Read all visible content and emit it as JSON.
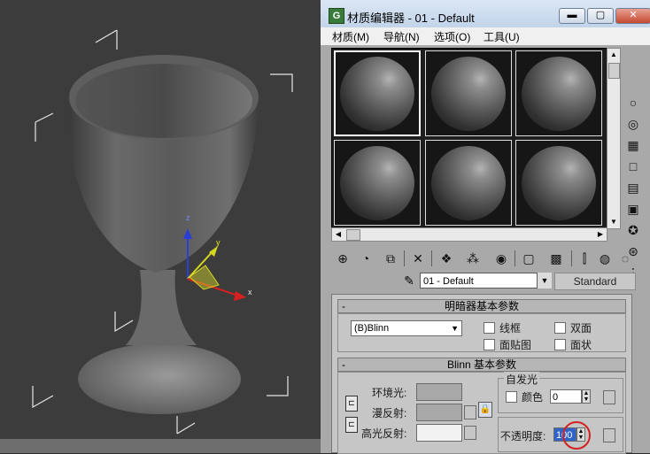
{
  "viewport": {
    "axes": {
      "z": "z",
      "y": "y",
      "x": "x"
    }
  },
  "window": {
    "title": "材质编辑器 - 01 - Default",
    "app_icon": "G",
    "buttons": {
      "minimize": "▬",
      "maximize": "▢",
      "close": "✕"
    }
  },
  "menu": {
    "items": [
      {
        "label": "材质(M)"
      },
      {
        "label": "导航(N)"
      },
      {
        "label": "选项(O)"
      },
      {
        "label": "工具(U)"
      }
    ]
  },
  "sample_slots": {
    "count": 6,
    "active_index": 0
  },
  "side_toolbar": {
    "icons": [
      "sample-type-sphere-icon",
      "backlight-icon",
      "background-checker-icon",
      "sample-uv-tiling-icon",
      "video-color-check-icon",
      "make-preview-icon",
      "options-icon",
      "select-by-material-icon",
      "material-navigator-icon"
    ]
  },
  "bottom_toolbar": {
    "icons": [
      "get-material-icon",
      "put-to-scene-icon",
      "assign-to-selection-icon",
      "reset-map-icon",
      "make-unique-icon",
      "put-to-library-icon",
      "material-effects-channel-icon",
      "show-map-icon",
      "show-end-result-icon",
      "go-to-parent-icon",
      "go-forward-sibling-icon",
      "go-sibling-icon"
    ]
  },
  "material": {
    "name": "01 - Default",
    "type": "Standard"
  },
  "shader_basic": {
    "title": "明暗器基本参数",
    "collapse": "-",
    "shader": "(B)Blinn",
    "wire_label": "线框",
    "two_sided_label": "双面",
    "face_map_label": "面贴图",
    "faceted_label": "面状"
  },
  "blinn_basic": {
    "title": "Blinn 基本参数",
    "collapse": "-",
    "ambient_label": "环境光:",
    "diffuse_label": "漫反射:",
    "specular_label": "高光反射:",
    "self_illum_group": "自发光",
    "color_label": "颜色",
    "self_illum_value": "0",
    "opacity_label": "不透明度:",
    "opacity_value": "100",
    "colors": {
      "ambient": "#a8a8a8",
      "diffuse": "#a8a8a8",
      "specular": "#f2f2f2"
    }
  },
  "accent": {
    "highlight_circle": "#d42020"
  }
}
